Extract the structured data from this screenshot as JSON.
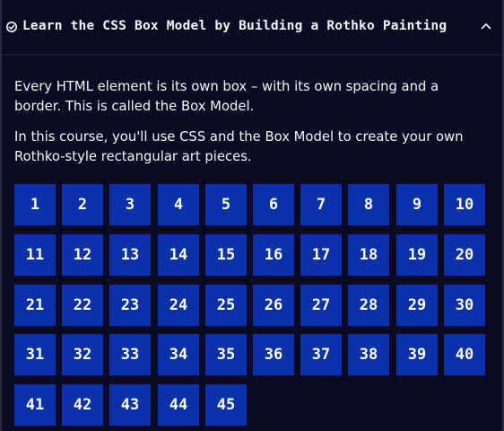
{
  "header": {
    "title": "Learn the CSS Box Model by Building a Rothko Painting",
    "icon": "check-circle-icon",
    "toggle_icon": "chevron-up-icon"
  },
  "intro": {
    "paragraph1": "Every HTML element is its own box – with its own spacing and a border. This is called the Box Model.",
    "paragraph2": "In this course, you'll use CSS and the Box Model to create your own Rothko-style rectangular art pieces."
  },
  "steps": [
    "1",
    "2",
    "3",
    "4",
    "5",
    "6",
    "7",
    "8",
    "9",
    "10",
    "11",
    "12",
    "13",
    "14",
    "15",
    "16",
    "17",
    "18",
    "19",
    "20",
    "21",
    "22",
    "23",
    "24",
    "25",
    "26",
    "27",
    "28",
    "29",
    "30",
    "31",
    "32",
    "33",
    "34",
    "35",
    "36",
    "37",
    "38",
    "39",
    "40",
    "41",
    "42",
    "43",
    "44",
    "45"
  ],
  "colors": {
    "background": "#0a0a23",
    "step_button": "#0a31a9",
    "text": "#f5f6f7"
  }
}
